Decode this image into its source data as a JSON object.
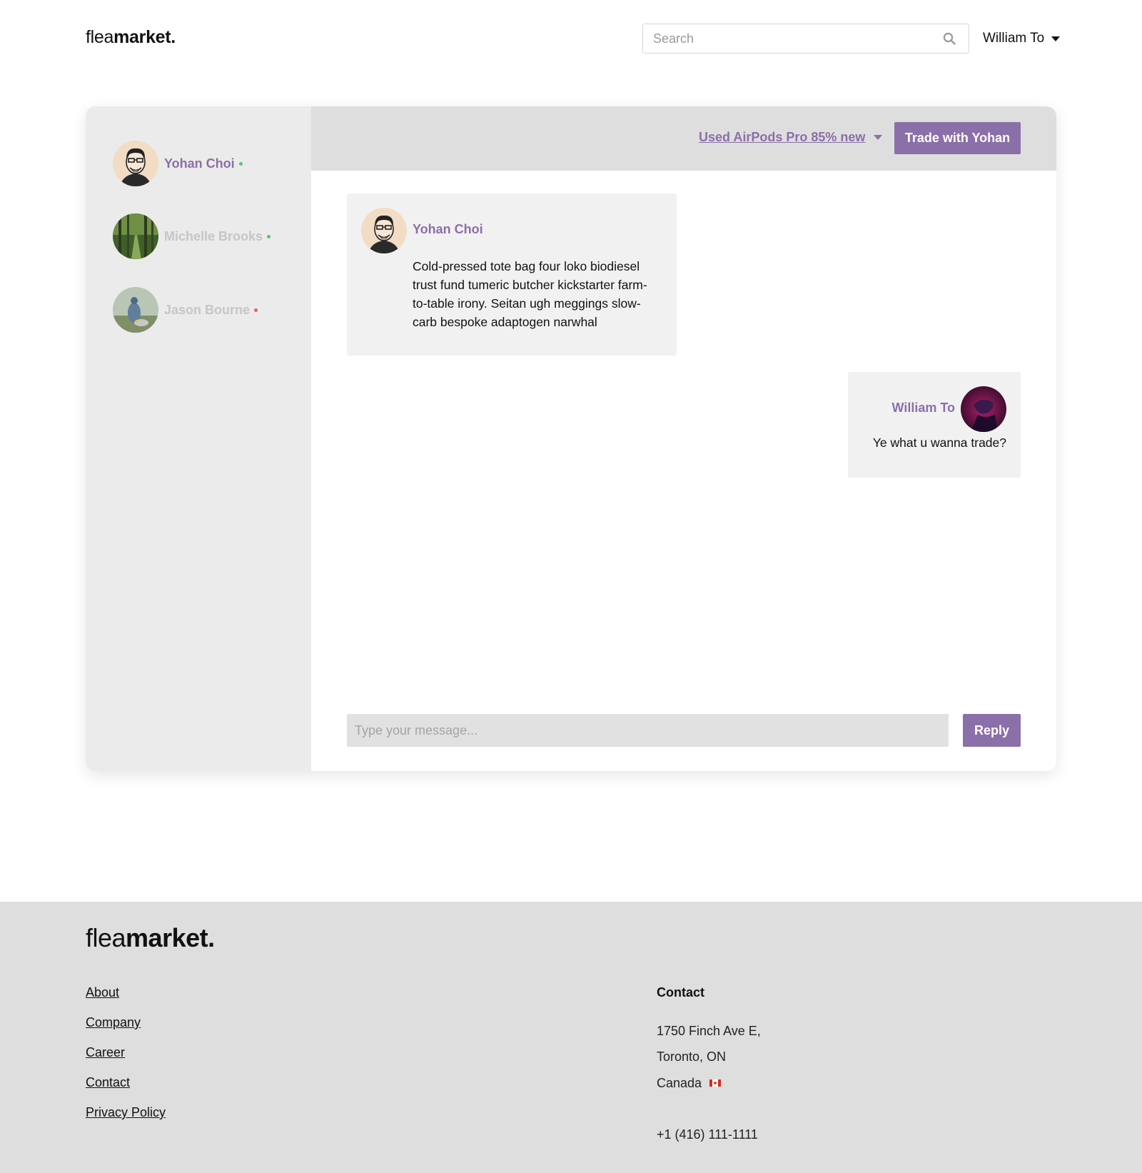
{
  "header": {
    "logo_light": "flea",
    "logo_bold": "market.",
    "search_placeholder": "Search",
    "user_name": "William To"
  },
  "sidebar": {
    "contacts": [
      {
        "name": "Yohan Choi",
        "status_color": "#5fbf7f",
        "active": true
      },
      {
        "name": "Michelle Brooks",
        "status_color": "#5fbf7f",
        "active": false
      },
      {
        "name": "Jason Bourne",
        "status_color": "#e0615c",
        "active": false
      }
    ]
  },
  "chat": {
    "item_label": "Used AirPods Pro 85% new",
    "trade_button": "Trade with Yohan",
    "messages": [
      {
        "sender": "Yohan Choi",
        "text": "Cold-pressed tote bag four loko biodiesel trust fund tumeric butcher kickstarter farm-to-table irony. Seitan ugh meggings slow-carb bespoke adaptogen narwhal"
      },
      {
        "sender": "William To",
        "text": "Ye what u wanna trade?"
      }
    ],
    "compose_placeholder": "Type your message...",
    "reply_button": "Reply"
  },
  "footer": {
    "logo_light": "flea",
    "logo_bold": "market.",
    "links": [
      "About",
      "Company",
      "Career",
      "Contact",
      "Privacy Policy"
    ],
    "contact_heading": "Contact",
    "address_line1": "1750 Finch Ave E,",
    "address_line2": "Toronto, ON",
    "address_line3": "Canada",
    "phone": "+1 (416) 111-1111"
  },
  "colors": {
    "accent": "#8b6fa8",
    "inactive_text": "#c6c6c6",
    "sidebar_bg": "#ebebeb",
    "header_bg": "#dedede",
    "bubble_bg": "#f1f1f1",
    "footer_bg": "#dedede"
  },
  "icons": {
    "search": "search-icon",
    "user_caret": "chevron-down-icon",
    "item_caret": "chevron-down-icon",
    "flag": "canada-flag-icon"
  }
}
